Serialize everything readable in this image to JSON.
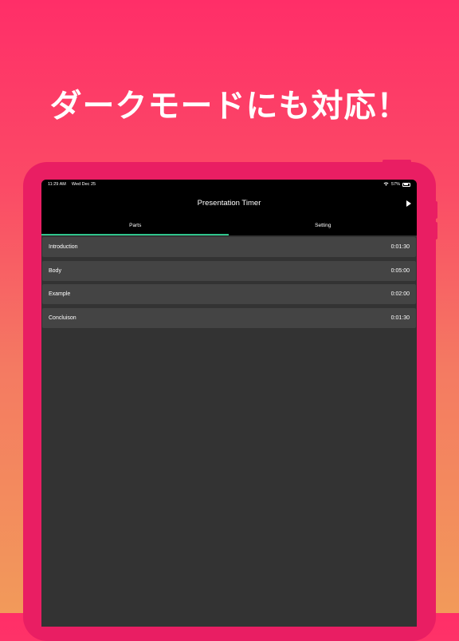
{
  "headline": "ダークモードにも対応！",
  "status_bar": {
    "time": "11:29 AM",
    "date": "Wed Dec 25",
    "battery": "57%"
  },
  "nav": {
    "title": "Presentation Timer"
  },
  "tabs": [
    {
      "label": "Parts",
      "selected": true
    },
    {
      "label": "Setting",
      "selected": false
    }
  ],
  "parts": [
    {
      "name": "Introduction",
      "duration": "0:01:30"
    },
    {
      "name": "Body",
      "duration": "0:05:00"
    },
    {
      "name": "Example",
      "duration": "0:02:00"
    },
    {
      "name": "Concluison",
      "duration": "0:01:30"
    }
  ],
  "colors": {
    "device": "#e91e63",
    "tab_indicator": "#2fc48c",
    "list_item": "#444444",
    "screen_bg": "#333333"
  },
  "icons": [
    "wifi-icon",
    "battery-icon",
    "play-icon"
  ]
}
